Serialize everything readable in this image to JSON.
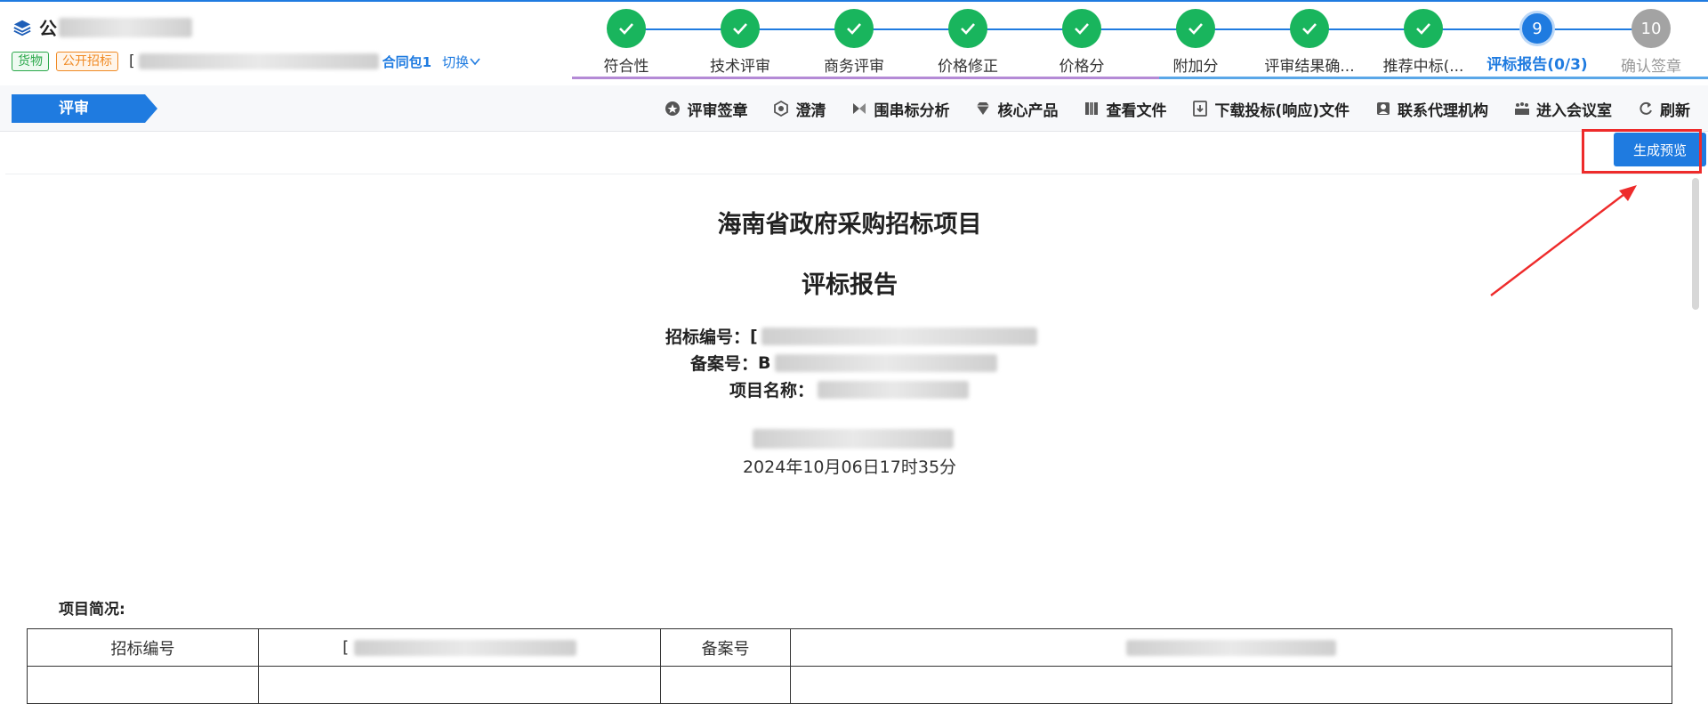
{
  "header": {
    "project_title": "公",
    "tags": {
      "goods": "货物",
      "open_bid": "公开招标"
    },
    "bracket": "[",
    "package_label": "合同包1",
    "switch_label": "切换"
  },
  "steps": [
    {
      "label": "符合性",
      "status": "done"
    },
    {
      "label": "技术评审",
      "status": "done"
    },
    {
      "label": "商务评审",
      "status": "done"
    },
    {
      "label": "价格修正",
      "status": "done"
    },
    {
      "label": "价格分",
      "status": "done"
    },
    {
      "label": "附加分",
      "status": "done"
    },
    {
      "label": "评审结果确...",
      "status": "done"
    },
    {
      "label": "推荐中标(...",
      "status": "done"
    },
    {
      "label": "评标报告(0/3)",
      "status": "current",
      "number": "9"
    },
    {
      "label": "确认签章",
      "status": "todo",
      "number": "10"
    }
  ],
  "toolbar": {
    "review_tab": "评审",
    "tools": [
      {
        "label": "评审签章",
        "icon": "seal-icon"
      },
      {
        "label": "澄清",
        "icon": "clarify-icon"
      },
      {
        "label": "围串标分析",
        "icon": "analysis-icon"
      },
      {
        "label": "核心产品",
        "icon": "diamond-icon"
      },
      {
        "label": "查看文件",
        "icon": "files-icon"
      },
      {
        "label": "下载投标(响应)文件",
        "icon": "download-icon"
      },
      {
        "label": "联系代理机构",
        "icon": "contact-icon"
      },
      {
        "label": "进入会议室",
        "icon": "meeting-icon"
      },
      {
        "label": "刷新",
        "icon": "refresh-icon"
      }
    ]
  },
  "preview_button": "生成预览",
  "document": {
    "main_title": "海南省政府采购招标项目",
    "sub_title": "评标报告",
    "bid_no_label": "招标编号：",
    "bid_no_value": "[",
    "record_no_label": "备案号：",
    "record_no_value": "B",
    "project_name_label": "项目名称：",
    "date": "2024年10月06日17时35分",
    "summary_label": "项目简况:"
  },
  "table": {
    "row1": {
      "c1": "招标编号",
      "c2": "[",
      "c3": "备案号",
      "c4": ""
    }
  },
  "colors": {
    "primary": "#1f7be0",
    "done": "#19b55d",
    "todo": "#a3a3a3",
    "highlight": "#ee2b2b"
  }
}
